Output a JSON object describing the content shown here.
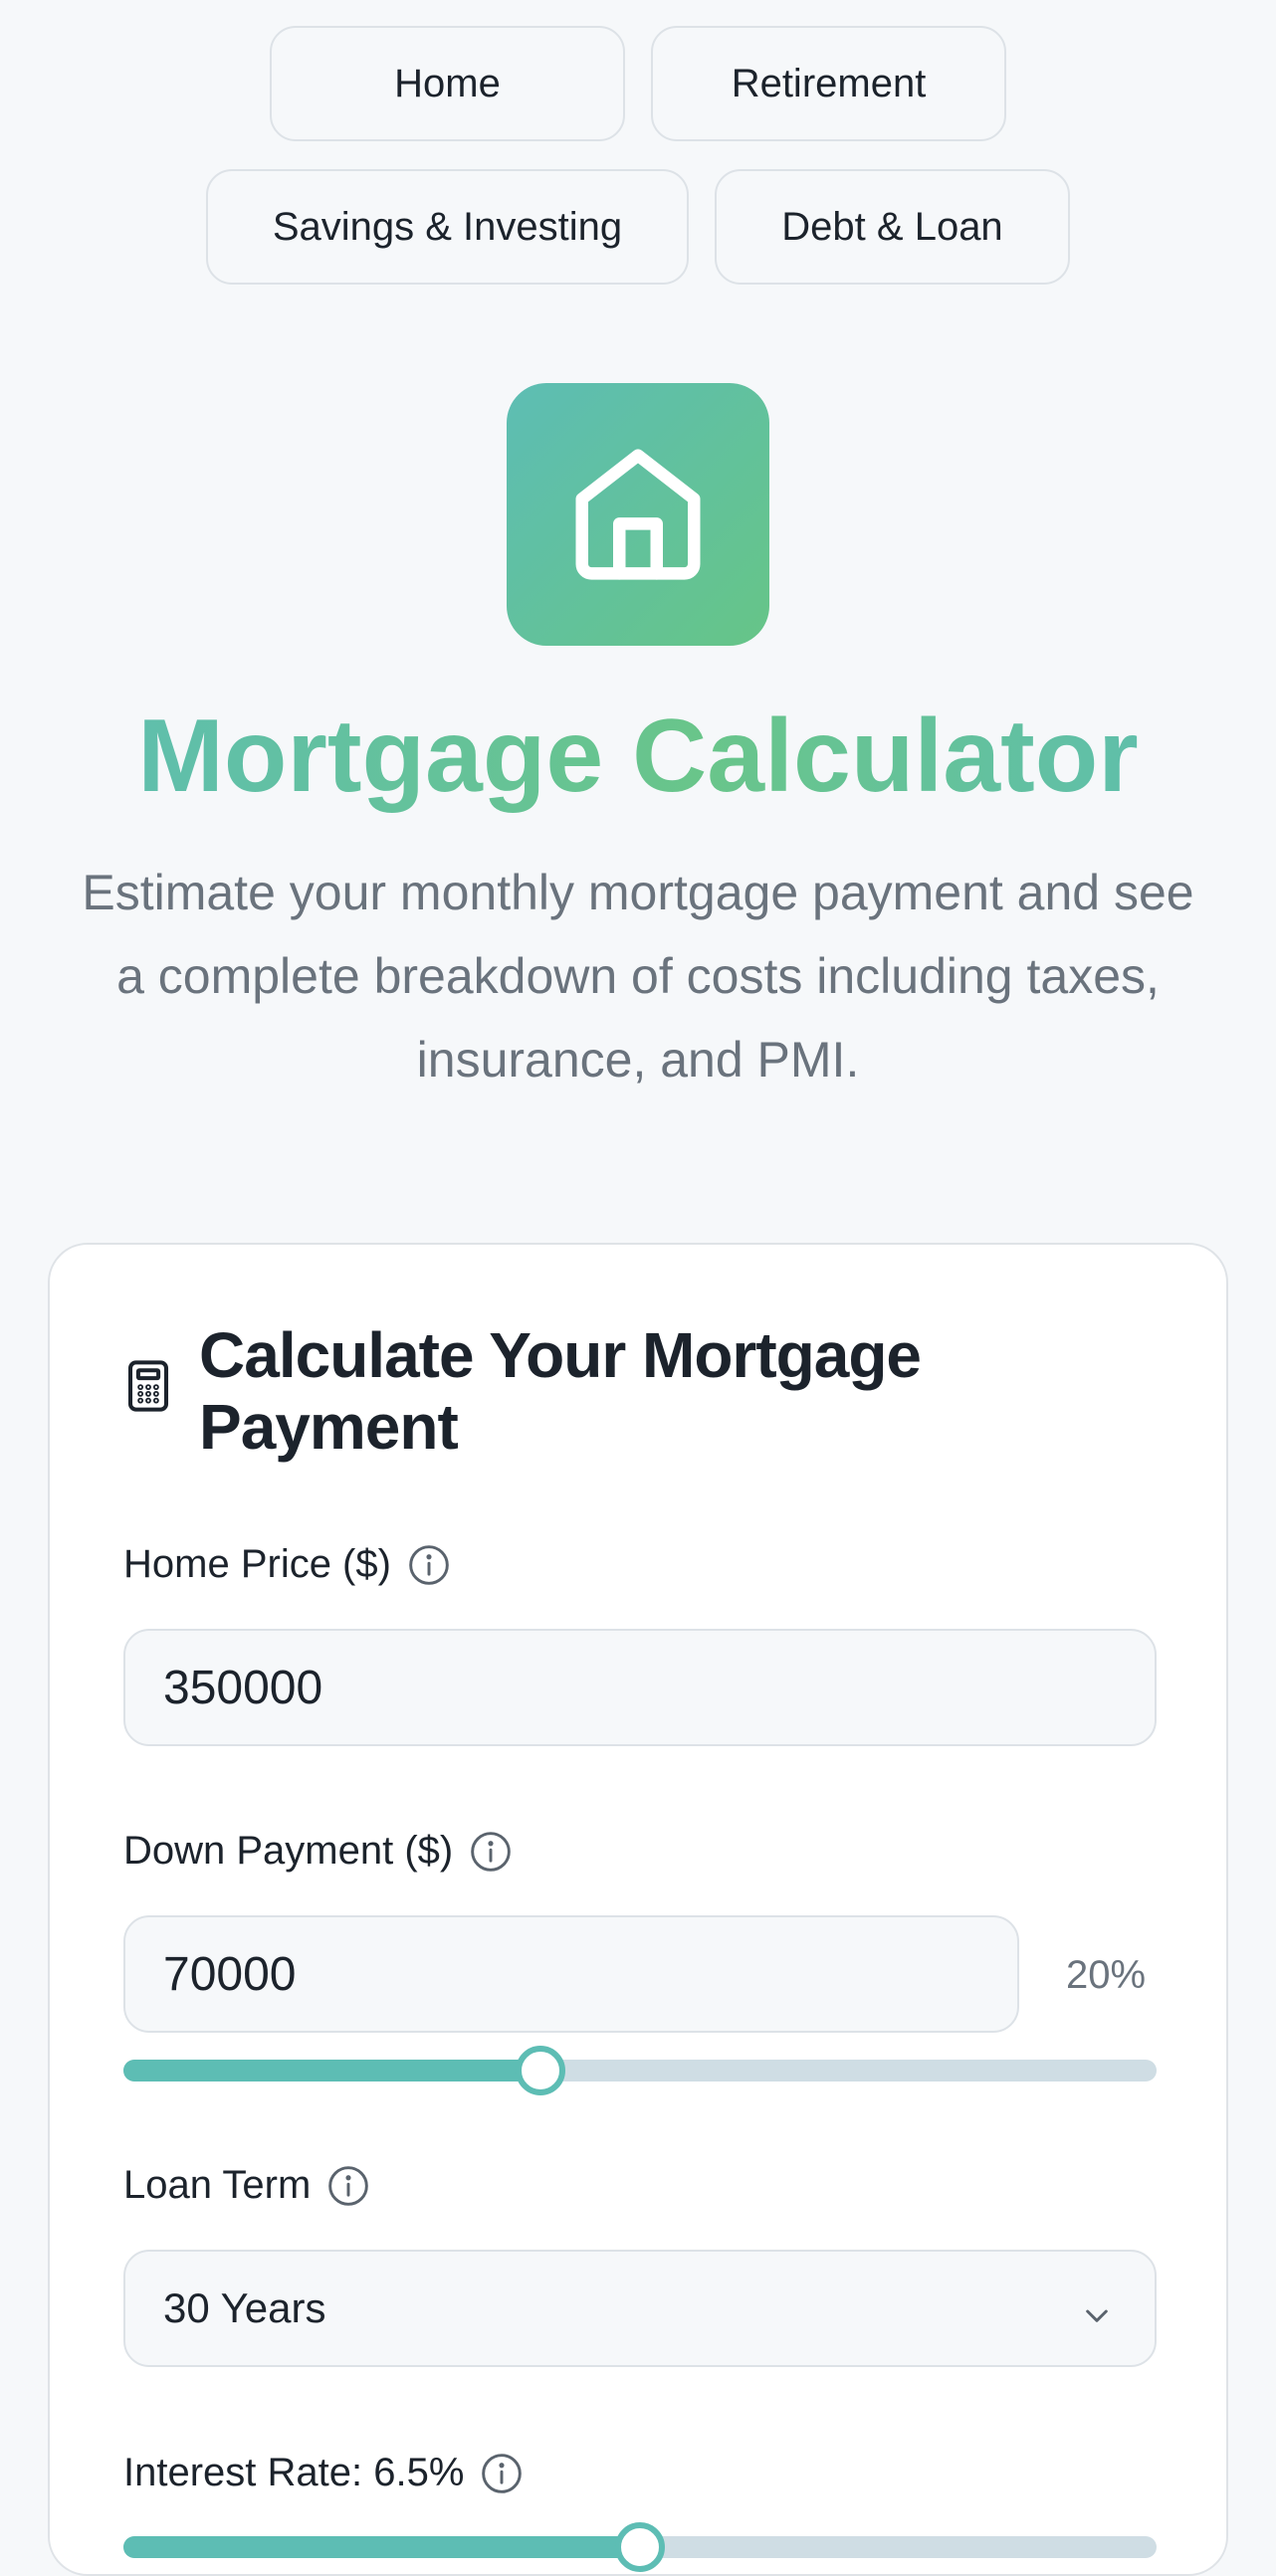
{
  "nav": {
    "home": "Home",
    "retirement": "Retirement",
    "savings": "Savings & Investing",
    "debt": "Debt & Loan"
  },
  "hero": {
    "icon": "house-icon",
    "title": "Mortgage Calculator",
    "subtitle": "Estimate your monthly mortgage payment and see a complete breakdown of costs including taxes, insurance, and PMI."
  },
  "calculator": {
    "icon": "calculator-icon",
    "title": "Calculate Your Mortgage Payment",
    "home_price": {
      "label": "Home Price ($)",
      "value": "350000"
    },
    "down_payment": {
      "label": "Down Payment ($)",
      "value": "70000",
      "percent": "20%",
      "slider_fraction": 0.404
    },
    "loan_term": {
      "label": "Loan Term",
      "selected": "30 Years"
    },
    "interest_rate": {
      "label": "Interest Rate: 6.5%",
      "slider_fraction": 0.5
    }
  },
  "colors": {
    "accent": "#5dbdb4",
    "accent_green": "#66c587",
    "text": "#1c232c",
    "muted": "#6a737d"
  }
}
